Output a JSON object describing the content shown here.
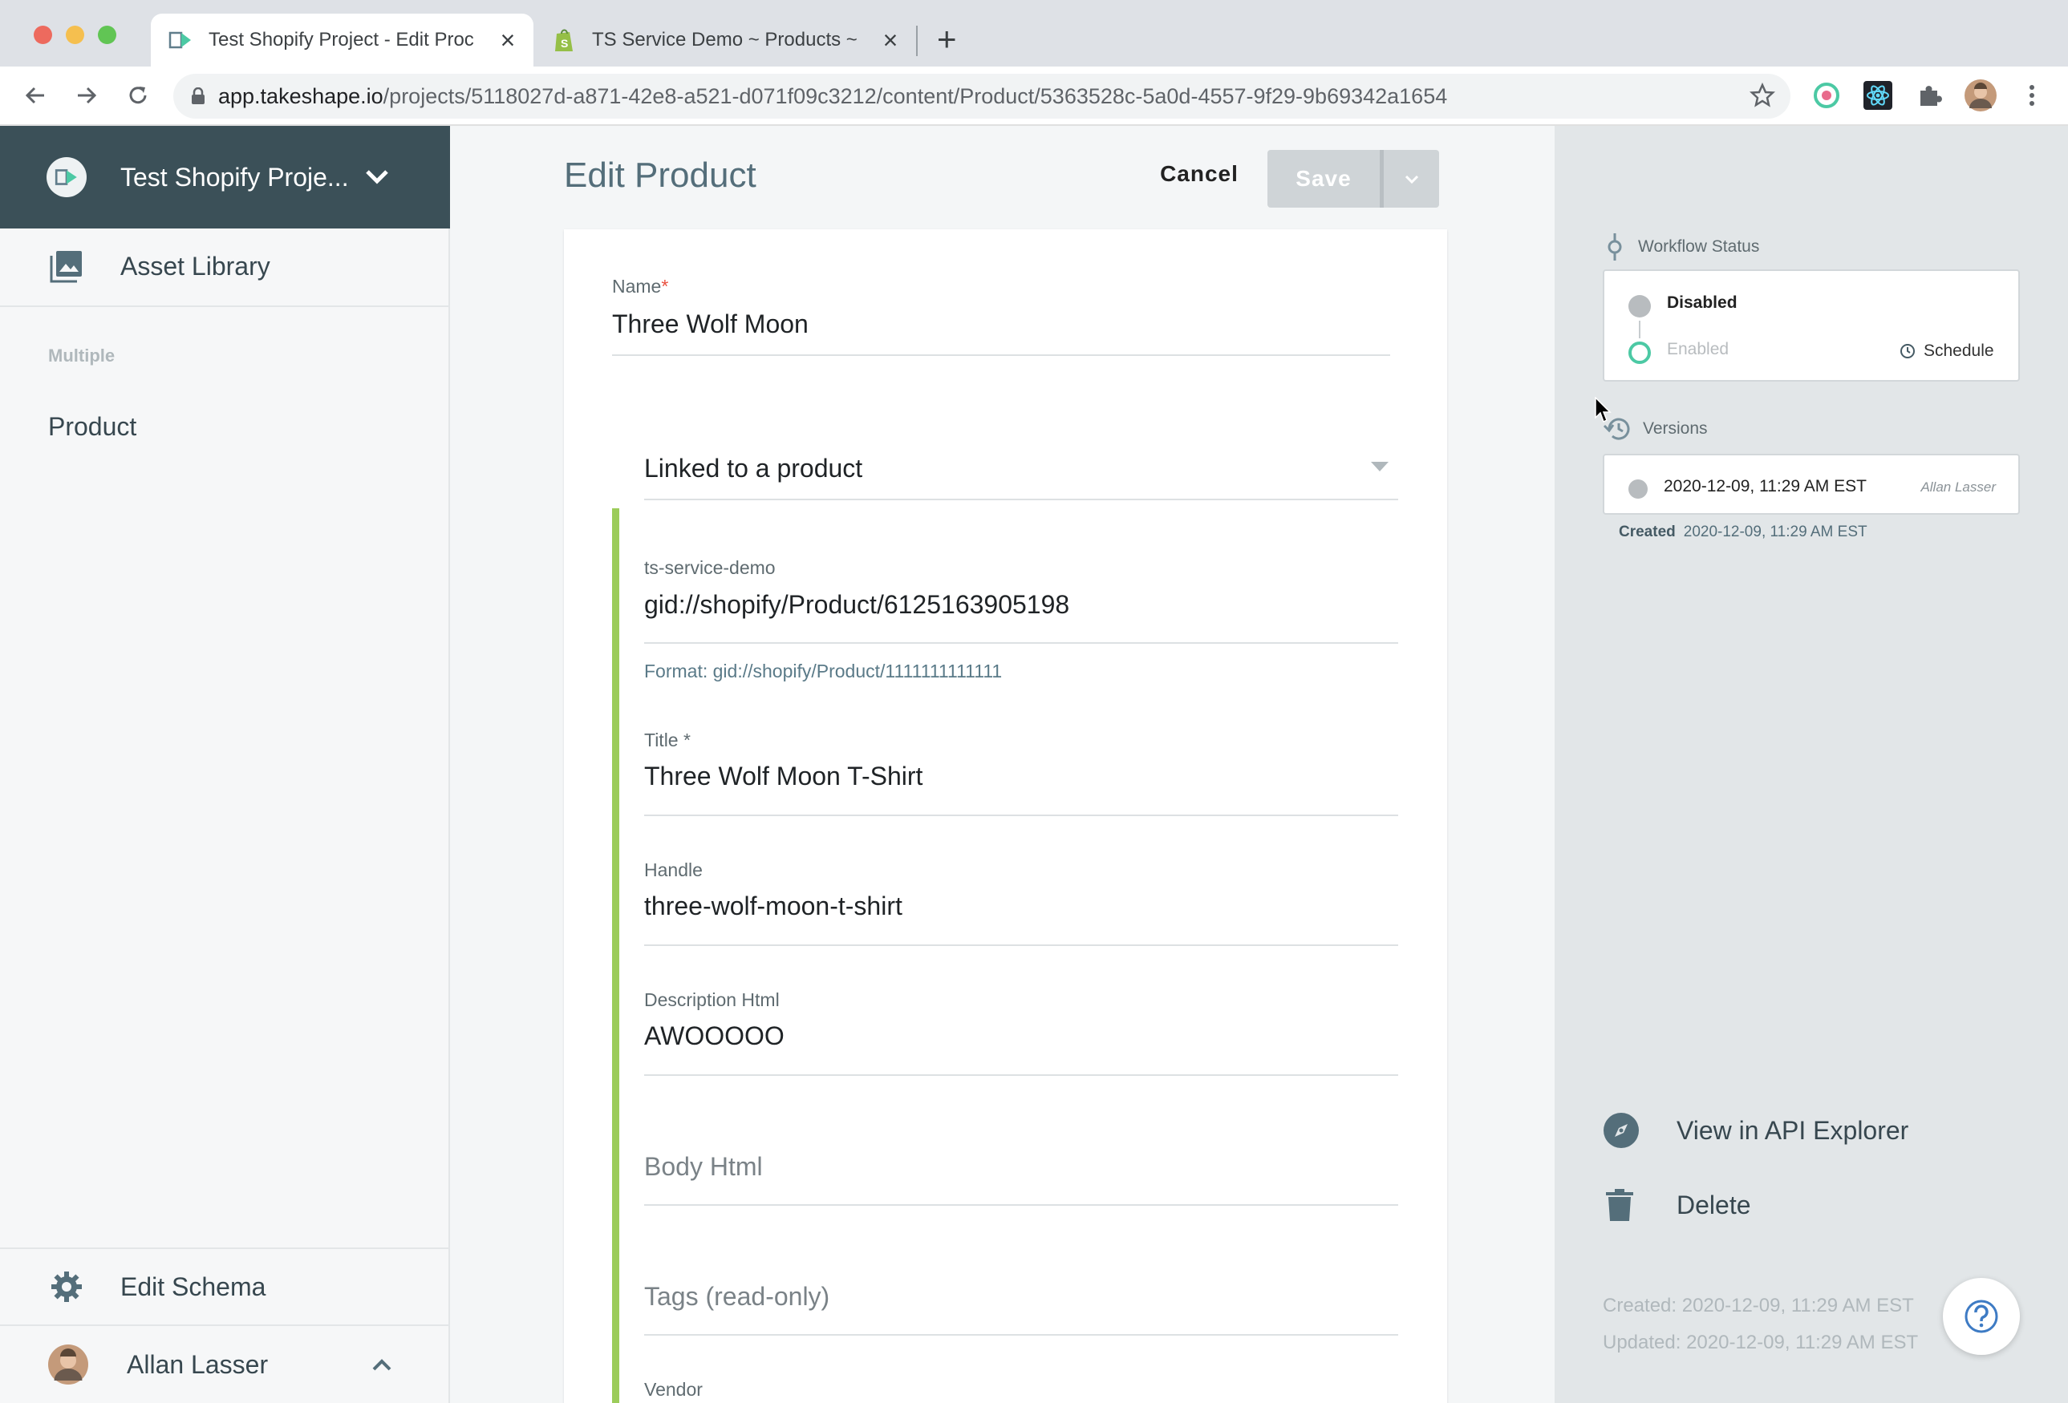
{
  "browser": {
    "tabs": [
      {
        "title": "Test Shopify Project - Edit Proc",
        "active": true,
        "icon": "takeshape-icon"
      },
      {
        "title": "TS Service Demo ~ Products ~",
        "active": false,
        "icon": "shopify-icon"
      }
    ],
    "url_host": "app.takeshape.io",
    "url_path": "/projects/5118027d-a871-42e8-a521-d071f09c3212/content/Product/5363528c-5a0d-4557-9f29-9b69342a1654"
  },
  "sidebar": {
    "project_name": "Test Shopify Proje...",
    "asset_library": "Asset Library",
    "section_label": "Multiple",
    "product": "Product",
    "edit_schema": "Edit Schema",
    "user_name": "Allan Lasser"
  },
  "main": {
    "title": "Edit Product",
    "cancel_label": "Cancel",
    "save_label": "Save",
    "name_label": "Name",
    "name_required": "*",
    "name_value": "Three Wolf Moon",
    "linked_label": "Linked to a product",
    "service_label": "ts-service-demo",
    "service_value": "gid://shopify/Product/6125163905198",
    "service_hint": "Format: gid://shopify/Product/1111111111111",
    "title_label": "Title *",
    "title_value": "Three Wolf Moon T-Shirt",
    "handle_label": "Handle",
    "handle_value": "three-wolf-moon-t-shirt",
    "desc_label": "Description Html",
    "desc_value": "AWOOOOO",
    "body_placeholder": "Body Html",
    "tags_placeholder": "Tags (read-only)",
    "vendor_label": "Vendor"
  },
  "right": {
    "workflow_heading": "Workflow Status",
    "status_disabled": "Disabled",
    "status_enabled": "Enabled",
    "schedule_label": "Schedule",
    "versions_heading": "Versions",
    "version_date": "2020-12-09, 11:29 AM EST",
    "version_author": "Allan Lasser",
    "created_label": "Created",
    "created_date": "2020-12-09, 11:29 AM EST",
    "api_explorer": "View in API Explorer",
    "delete_label": "Delete",
    "footer_created": "Created: 2020-12-09, 11:29 AM EST",
    "footer_updated": "Updated: 2020-12-09, 11:29 AM EST"
  },
  "colors": {
    "header_bg": "#3b5058",
    "accent_green": "#9ccc5a",
    "enabled_ring": "#4cc9a4",
    "save_disabled": "#cfd4d7"
  }
}
